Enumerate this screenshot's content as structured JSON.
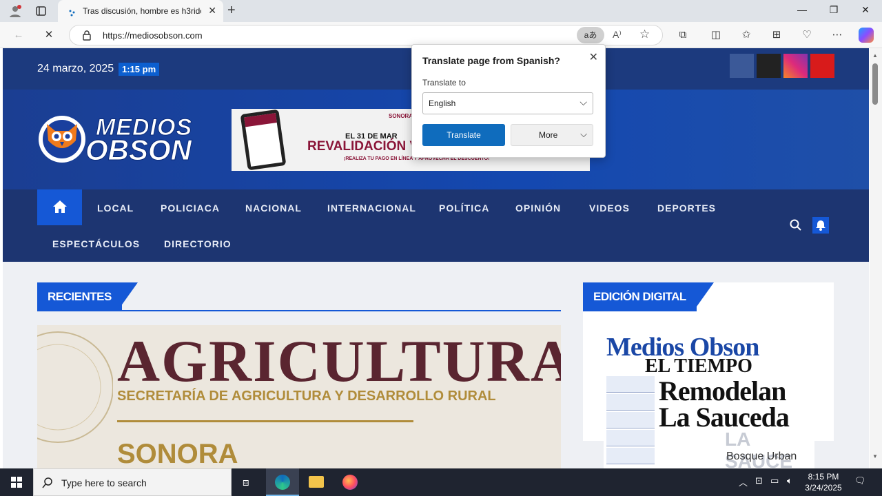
{
  "browser": {
    "tab_title": "Tras discusión, hombre es h3rido",
    "url": "https://mediosobson.com",
    "colors": {
      "tab_bg": "#f7f7f7",
      "chrome_bg": "#dfe3e8"
    }
  },
  "site": {
    "date": "24 marzo, 2025",
    "time": "1:15 pm",
    "logo_line1": "MEDIOS",
    "logo_line2": "OBSON",
    "social_colors": [
      "#3b5998",
      "#222222",
      "#e1306c",
      "#d81b1b"
    ],
    "banner": {
      "top": "SONORA",
      "line1": "EL 31 DE MAR",
      "line2": "REVALIDACIÓN V",
      "line3": "¡REALIZA TU PAGO EN LÍNEA Y APROVECHA EL DESCUENTO!"
    },
    "nav_row1": [
      "LOCAL",
      "POLICIACA",
      "NACIONAL",
      "INTERNACIONAL",
      "POLÍTICA",
      "OPINIÓN",
      "VIDEOS",
      "DEPORTES"
    ],
    "nav_row2": [
      "ESPECTÁCULOS",
      "DIRECTORIO"
    ],
    "section_recent": "RECIENTES",
    "section_digital": "EDICIÓN DIGITAL",
    "hero": {
      "headline": "AGRICULTURA",
      "sub": "SECRETARÍA DE AGRICULTURA Y DESARROLLO RURAL",
      "state": "SONORA"
    },
    "paper": {
      "masthead": "Medios Obson",
      "subtitle": "EL TIEMPO",
      "head1": "Remodelan",
      "head2": "La Sauceda",
      "brand": "LA SAUCE",
      "tag": "Bosque Urban"
    }
  },
  "translate": {
    "title": "Translate page from Spanish?",
    "label": "Translate to",
    "language": "English",
    "primary": "Translate",
    "secondary": "More"
  },
  "taskbar": {
    "search_placeholder": "Type here to search",
    "time": "8:15 PM",
    "date": "3/24/2025"
  }
}
